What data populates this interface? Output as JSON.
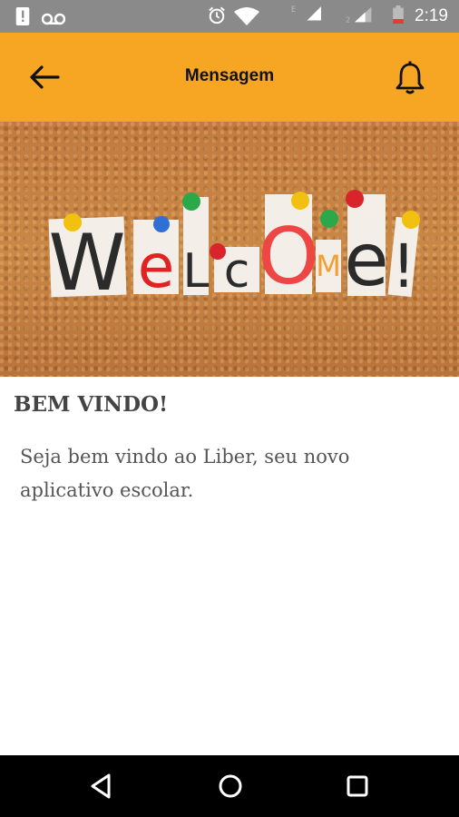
{
  "status_bar": {
    "time": "2:19",
    "icons": [
      "alert-icon",
      "voicemail-icon",
      "alarm-icon",
      "wifi-icon",
      "signal-icon",
      "signal-icon",
      "battery-icon"
    ]
  },
  "app_bar": {
    "title": "Mensagem",
    "back_icon": "arrow-left-icon",
    "bell_icon": "bell-icon",
    "background_color": "#f7a623"
  },
  "banner": {
    "image": "welcome-letters-corkboard",
    "text": "WELCOME!"
  },
  "message": {
    "title": "BEM VINDO!",
    "body": "Seja bem vindo ao Liber, seu novo aplicativo escolar."
  },
  "nav_bar": {
    "icons": [
      "back-triangle-icon",
      "home-circle-icon",
      "recents-square-icon"
    ]
  }
}
